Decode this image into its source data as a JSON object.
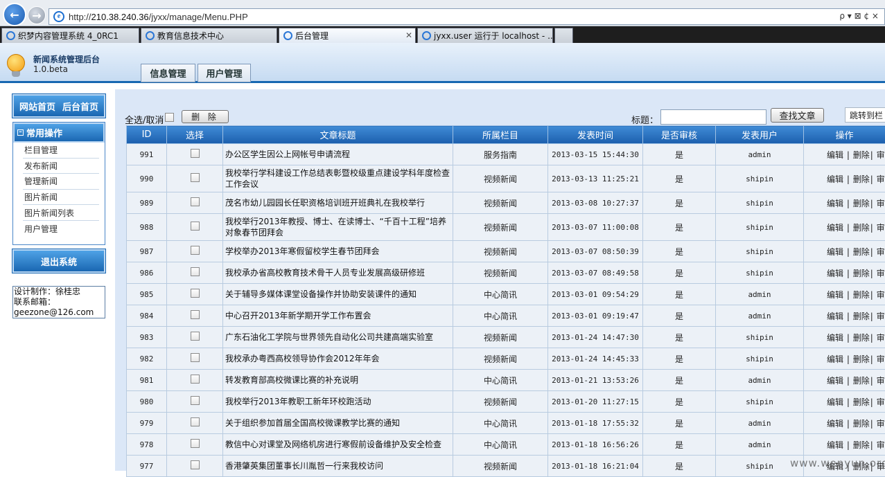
{
  "browser": {
    "url_prefix": "http://",
    "url_host": "210.38.240.36",
    "url_path": "/jyxx/manage/Menu.PHP",
    "address_tools": "ρ ▾ ⊠ ¢ ×",
    "tabs": [
      {
        "label": "织梦内容管理系统 4_0RC1",
        "active": false
      },
      {
        "label": "教育信息技术中心",
        "active": false
      },
      {
        "label": "后台管理",
        "active": true
      },
      {
        "label": "jyxx.user 运行于 localhost - ...",
        "active": false
      }
    ]
  },
  "header": {
    "title": "新闻系统管理后台",
    "version": "1.0.beta",
    "tab_info": "信息管理",
    "tab_user": "用户管理"
  },
  "sidebar": {
    "home_link": "网站首页",
    "admin_home_link": "后台首页",
    "menu_title": "常用操作",
    "items": [
      "栏目管理",
      "发布新闻",
      "管理新闻",
      "图片新闻",
      "图片新闻列表",
      "用户管理"
    ],
    "logout": "退出系统",
    "credit_designer": "设计制作：徐桂忠",
    "credit_email_label": "联系邮箱：",
    "credit_email": "geezone@126.com"
  },
  "toolbar": {
    "select_all": "全选/取消",
    "delete": "删 除",
    "title_label": "标题：",
    "title_value": "",
    "search_button": "查找文章",
    "jump_select": "跳转到栏"
  },
  "table": {
    "headers": [
      "ID",
      "选择",
      "文章标题",
      "所属栏目",
      "发表时间",
      "是否审核",
      "发表用户",
      "操作"
    ],
    "ops": [
      "编辑",
      "|",
      "删除",
      "|",
      "审"
    ],
    "rows": [
      {
        "id": "991",
        "title": "办公区学生因公上网帐号申请流程",
        "column": "服务指南",
        "time": "2013-03-15 15:44:30",
        "approved": "是",
        "user": "admin"
      },
      {
        "id": "990",
        "title": "我校举行学科建设工作总结表彰暨校级重点建设学科年度检查工作会议",
        "column": "视频新闻",
        "time": "2013-03-13 11:25:21",
        "approved": "是",
        "user": "shipin"
      },
      {
        "id": "989",
        "title": "茂名市幼儿园园长任职资格培训班开班典礼在我校举行",
        "column": "视频新闻",
        "time": "2013-03-08 10:27:37",
        "approved": "是",
        "user": "shipin"
      },
      {
        "id": "988",
        "title": "我校举行2013年教授、博士、在读博士、“千百十工程”培养对象春节团拜会",
        "column": "视频新闻",
        "time": "2013-03-07 11:00:08",
        "approved": "是",
        "user": "shipin"
      },
      {
        "id": "987",
        "title": "学校举办2013年寒假留校学生春节团拜会",
        "column": "视频新闻",
        "time": "2013-03-07 08:50:39",
        "approved": "是",
        "user": "shipin"
      },
      {
        "id": "986",
        "title": "我校承办省高校教育技术骨干人员专业发展高级研修班",
        "column": "视频新闻",
        "time": "2013-03-07 08:49:58",
        "approved": "是",
        "user": "shipin"
      },
      {
        "id": "985",
        "title": "关于辅导多媒体课堂设备操作并协助安装课件的通知",
        "column": "中心简讯",
        "time": "2013-03-01 09:54:29",
        "approved": "是",
        "user": "admin"
      },
      {
        "id": "984",
        "title": "中心召开2013年新学期开学工作布置会",
        "column": "中心简讯",
        "time": "2013-03-01 09:19:47",
        "approved": "是",
        "user": "admin"
      },
      {
        "id": "983",
        "title": "广东石油化工学院与世界领先自动化公司共建高端实验室",
        "column": "视频新闻",
        "time": "2013-01-24 14:47:30",
        "approved": "是",
        "user": "shipin"
      },
      {
        "id": "982",
        "title": "我校承办粤西高校领导协作会2012年年会",
        "column": "视频新闻",
        "time": "2013-01-24 14:45:33",
        "approved": "是",
        "user": "shipin"
      },
      {
        "id": "981",
        "title": "转发教育部高校微课比赛的补充说明",
        "column": "中心简讯",
        "time": "2013-01-21 13:53:26",
        "approved": "是",
        "user": "admin"
      },
      {
        "id": "980",
        "title": "我校举行2013年教职工新年环校跑活动",
        "column": "视频新闻",
        "time": "2013-01-20 11:27:15",
        "approved": "是",
        "user": "shipin"
      },
      {
        "id": "979",
        "title": "关于组织参加首届全国高校微课教学比赛的通知",
        "column": "中心简讯",
        "time": "2013-01-18 17:55:32",
        "approved": "是",
        "user": "admin"
      },
      {
        "id": "978",
        "title": "教信中心对课堂及网络机房进行寒假前设备维护及安全检查",
        "column": "中心简讯",
        "time": "2013-01-18 16:56:26",
        "approved": "是",
        "user": "admin"
      },
      {
        "id": "977",
        "title": "香港肇英集团董事长川胤哲一行来我校访问",
        "column": "视频新闻",
        "time": "2013-01-18 16:21:04",
        "approved": "是",
        "user": "shipin"
      }
    ]
  },
  "watermark": "www.wenyun.org"
}
